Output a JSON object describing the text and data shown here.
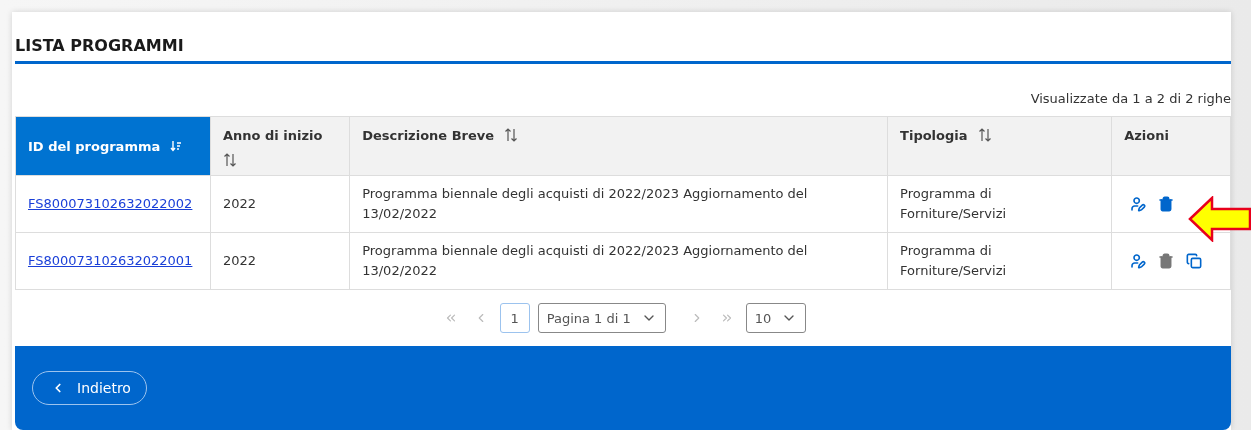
{
  "title": "LISTA PROGRAMMI",
  "record_count": "Visualizzate da 1 a 2 di 2 righe",
  "table": {
    "columns": [
      {
        "label": "ID del programma",
        "sortable": true,
        "selected": true
      },
      {
        "label": "Anno di inizio",
        "sortable": true,
        "selected": false
      },
      {
        "label": "Descrizione Breve",
        "sortable": true,
        "selected": false
      },
      {
        "label": "Tipologia",
        "sortable": true,
        "selected": false
      },
      {
        "label": "Azioni",
        "sortable": false,
        "selected": false
      }
    ],
    "rows": [
      {
        "id": "FS800073102632022002",
        "year": "2022",
        "description": "Programma biennale degli acquisti di 2022/2023 Aggiornamento del 13/02/2022",
        "type": "Programma di Forniture/Servizi",
        "actions": [
          {
            "kind": "edit",
            "disabled": false
          },
          {
            "kind": "delete",
            "disabled": false
          }
        ]
      },
      {
        "id": "FS800073102632022001",
        "year": "2022",
        "description": "Programma biennale degli acquisti di 2022/2023 Aggiornamento del 13/02/2022",
        "type": "Programma di Forniture/Servizi",
        "actions": [
          {
            "kind": "edit",
            "disabled": false
          },
          {
            "kind": "delete",
            "disabled": true
          },
          {
            "kind": "copy",
            "disabled": false
          }
        ]
      }
    ]
  },
  "pagination": {
    "first_disabled": true,
    "prev_disabled": true,
    "page": "1",
    "page_select": "Pagina 1 di 1",
    "next_disabled": true,
    "last_disabled": true,
    "page_size": "10"
  },
  "footer": {
    "back_button": "Indietro"
  }
}
